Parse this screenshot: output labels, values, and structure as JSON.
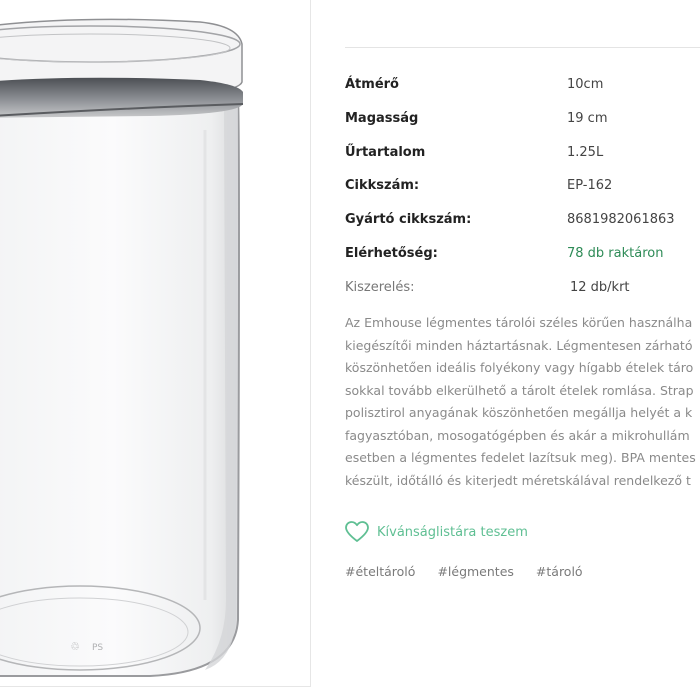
{
  "product_image": {
    "alt": "clear cylindrical storage jar"
  },
  "specs": [
    {
      "label": "Átmérő",
      "value": "10cm"
    },
    {
      "label": "Magasság",
      "value": "19 cm"
    },
    {
      "label": "Űrtartalom",
      "value": "1.25L"
    },
    {
      "label": "Cikkszám:",
      "value": "EP-162"
    },
    {
      "label": "Gyártó cikkszám:",
      "value": "8681982061863"
    },
    {
      "label": "Elérhetőség:",
      "value": "78 db raktáron"
    },
    {
      "label": "Kiszerelés:",
      "value": "12 db/krt"
    }
  ],
  "description_lines": [
    "Az Emhouse légmentes tárolói széles körűen használha",
    "kiegészítői minden háztartásnak. Légmentesen zárható",
    "köszönhetően ideális folyékony vagy hígabb ételek táro",
    "sokkal tovább elkerülhető a tárolt ételek romlása. Strap",
    "polisztirol anyagának köszönhetően megállja helyét a k",
    "fagyasztóban, mosogatógépben és akár a mikrohullám",
    "esetben a légmentes fedelet lazítsuk meg). BPA mentes",
    "készült, időtálló és kiterjedt méretskálával rendelkező t"
  ],
  "wishlist": {
    "label": "Kívánságlistára teszem",
    "icon": "heart-icon",
    "color": "#5fbf93"
  },
  "tags": [
    "#ételtároló",
    "#légmentes",
    "#tároló"
  ],
  "colors": {
    "stock": "#2e8b57",
    "accent": "#5fbf93"
  }
}
